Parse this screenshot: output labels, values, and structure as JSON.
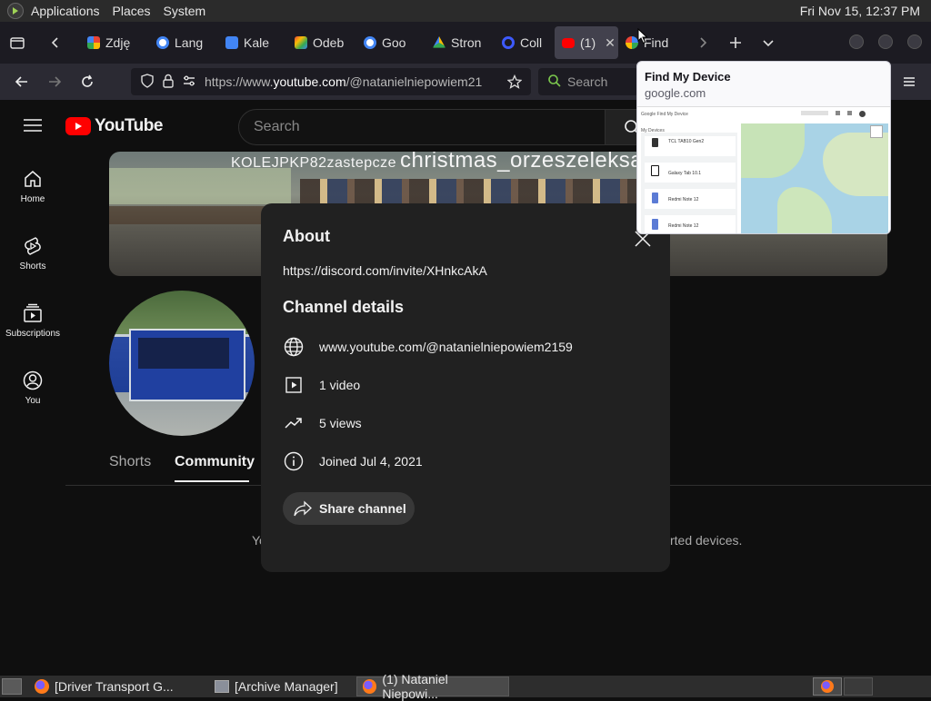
{
  "system_bar": {
    "menus": [
      "Applications",
      "Places",
      "System"
    ],
    "clock": "Fri Nov 15, 12:37 PM"
  },
  "browser": {
    "tabs": [
      {
        "label": "Zdję",
        "color": "#e6a23c"
      },
      {
        "label": "Lang",
        "color": "#4285f4"
      },
      {
        "label": "Kale",
        "color": "#4285f4"
      },
      {
        "label": "Odeb",
        "color": "#ea4335"
      },
      {
        "label": "Goo",
        "color": "#4285f4"
      },
      {
        "label": "Stron",
        "color": "#34a853"
      },
      {
        "label": "Coll",
        "color": "#3d5afe"
      },
      {
        "label": "(1)",
        "color": "#ff0000",
        "active": true
      },
      {
        "label": "Find",
        "color": "#34a853"
      }
    ],
    "url_prefix": "https://www.",
    "url_host": "youtube.com",
    "url_path": "/@natanielniepowiem21",
    "search_placeholder": "Search"
  },
  "youtube": {
    "logo_text": "YouTube",
    "search_placeholder": "Search",
    "sidebar": [
      {
        "label": "Home",
        "icon": "home-icon"
      },
      {
        "label": "Shorts",
        "icon": "shorts-icon"
      },
      {
        "label": "Subscriptions",
        "icon": "subscriptions-icon"
      },
      {
        "label": "You",
        "icon": "you-icon"
      }
    ],
    "banner_text_1": "KOLEJPKP82zastepcze",
    "banner_text_2": "christmas_orzeszeleksar",
    "channel_tabs": [
      "Shorts",
      "Community"
    ],
    "background_text_left": "Yo",
    "background_text_right": "rted devices."
  },
  "about_modal": {
    "title": "About",
    "link": "https://discord.com/invite/XHnkcAkA",
    "details_title": "Channel details",
    "url": "www.youtube.com/@natanielniepowiem2159",
    "videos": "1 video",
    "views": "5 views",
    "joined": "Joined Jul 4, 2021",
    "share_label": "Share channel"
  },
  "tab_preview": {
    "title": "Find My Device",
    "domain": "google.com",
    "thumb_header": "Google Find My Device",
    "thumb_section": "My Devices",
    "devices": [
      "TCL TAB10 Gen2",
      "Galaxy Tab 10.1",
      "Redmi Note 12",
      "Redmi Note 12"
    ]
  },
  "taskbar": {
    "tasks": [
      {
        "label": "[Driver Transport G...",
        "icon": "firefox-icon"
      },
      {
        "label": "[Archive Manager]",
        "icon": "archive-icon"
      },
      {
        "label": "(1) Nataniel Niepowi...",
        "icon": "firefox-icon",
        "active": true
      }
    ]
  },
  "colors": {
    "youtube_red": "#ff0000",
    "modal_bg": "#212121",
    "page_bg": "#0f0f0f"
  }
}
